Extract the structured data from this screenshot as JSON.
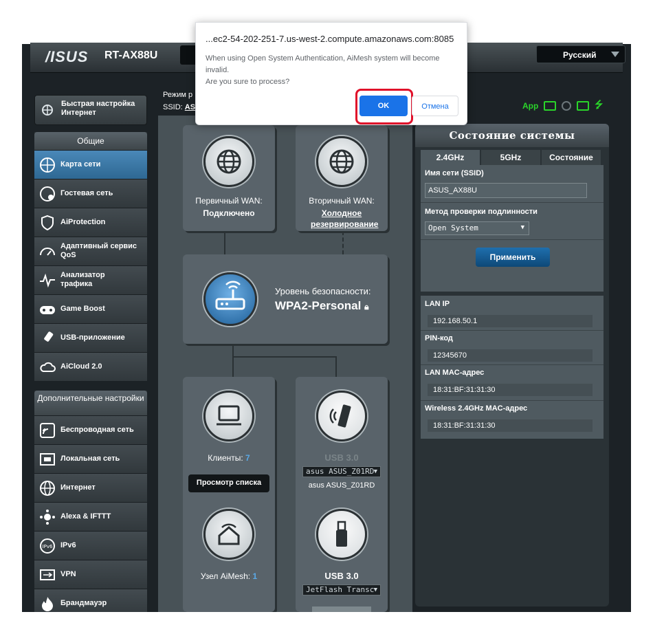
{
  "colors": {
    "accent_blue": "#1a73e8",
    "highlight_red": "#e0102a",
    "app_green": "#2ad42a",
    "active_menu": "#3a7aab"
  },
  "dialog": {
    "origin": "...ec2-54-202-251-7.us-west-2.compute.amazonaws.com:8085",
    "message": "When using Open System Authentication, AiMesh system will become invalid.\nAre you sure to process?",
    "ok_label": "OK",
    "cancel_label": "Отмена"
  },
  "header": {
    "brand": "/ISUS",
    "model": "RT-AX88U",
    "language": "Русский",
    "op_mode_prefix": "Режим р",
    "ssid_prefix": "SSID:",
    "ssid_value": "AS",
    "app_label": "App"
  },
  "sidebar": {
    "quick_setup": "Быстрая настройка Интернет",
    "general_title": "Общие",
    "general_items": [
      {
        "label": "Карта сети",
        "icon": "network-map-icon"
      },
      {
        "label": "Гостевая сеть",
        "icon": "guest-network-icon"
      },
      {
        "label": "AiProtection",
        "icon": "shield-icon"
      },
      {
        "label": "Адаптивный сервис QoS",
        "icon": "speedometer-icon"
      },
      {
        "label": "Анализатор трафика",
        "icon": "traffic-analyzer-icon"
      },
      {
        "label": "Game Boost",
        "icon": "gamepad-icon"
      },
      {
        "label": "USB-приложение",
        "icon": "usb-icon"
      },
      {
        "label": "AiCloud 2.0",
        "icon": "cloud-icon"
      }
    ],
    "advanced_title": "Дополнительные настройки",
    "advanced_items": [
      {
        "label": "Беспроводная сеть",
        "icon": "wireless-icon"
      },
      {
        "label": "Локальная сеть",
        "icon": "lan-icon"
      },
      {
        "label": "Интернет",
        "icon": "globe-icon"
      },
      {
        "label": "Alexa & IFTTT",
        "icon": "alexa-icon"
      },
      {
        "label": "IPv6",
        "icon": "ipv6-icon"
      },
      {
        "label": "VPN",
        "icon": "vpn-icon"
      },
      {
        "label": "Брандмауэр",
        "icon": "firewall-icon"
      }
    ]
  },
  "network_map": {
    "primary_wan_label": "Первичный WAN:",
    "primary_wan_status": "Подключено",
    "secondary_wan_label": "Вторичный WAN:",
    "secondary_wan_status": "Холодное резервирование",
    "security_label": "Уровень безопасности:",
    "security_value": "WPA2-Personal",
    "clients_label": "Клиенты:",
    "clients_count": "7",
    "view_list_label": "Просмотр списка",
    "aimesh_label": "Узел AiMesh:",
    "aimesh_count": "1",
    "usb1_label": "USB 3.0",
    "usb1_select": "asus ASUS_Z01RD",
    "usb1_device": "asus ASUS_Z01RD",
    "usb2_label": "USB 3.0",
    "usb2_select": "JetFlash Transc"
  },
  "system_status": {
    "title": "Состояние системы",
    "tabs": [
      "2.4GHz",
      "5GHz",
      "Состояние"
    ],
    "ssid_label": "Имя сети (SSID)",
    "ssid_value": "ASUS_AX88U",
    "auth_label": "Метод проверки подлинности",
    "auth_value": "Open System",
    "apply_label": "Применить",
    "lan_ip_label": "LAN IP",
    "lan_ip_value": "192.168.50.1",
    "pin_label": "PIN-код",
    "pin_value": "12345670",
    "lan_mac_label": "LAN MAC-адрес",
    "lan_mac_value": "18:31:BF:31:31:30",
    "wifi_mac_label": "Wireless 2.4GHz MAC-адрес",
    "wifi_mac_value": "18:31:BF:31:31:30"
  }
}
